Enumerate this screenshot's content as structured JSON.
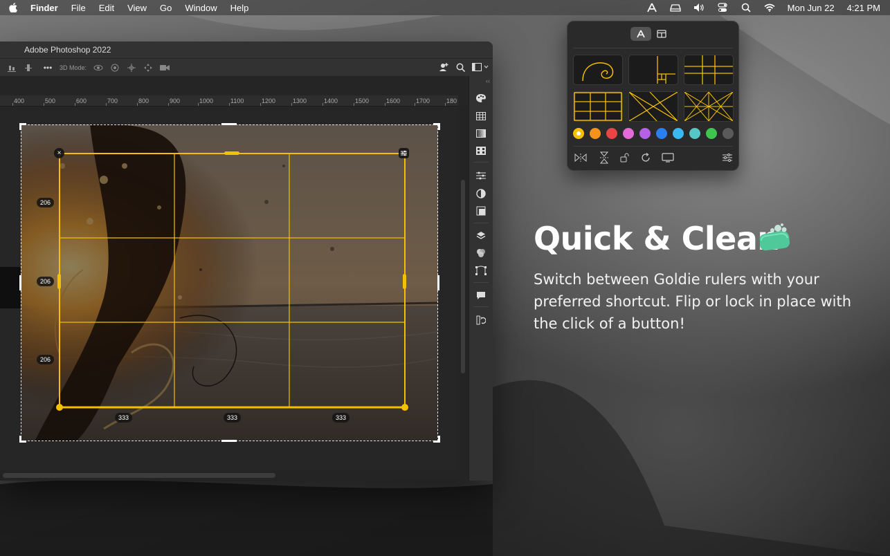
{
  "menubar": {
    "app_name": "Finder",
    "menus": [
      "File",
      "Edit",
      "View",
      "Go",
      "Window",
      "Help"
    ],
    "date": "Mon Jun 22",
    "time": "4:21 PM"
  },
  "photoshop": {
    "title": "Adobe Photoshop 2022",
    "options": {
      "mode_label": "3D Mode:"
    },
    "ruler_ticks": [
      "400",
      "500",
      "600",
      "700",
      "800",
      "900",
      "1000",
      "1100",
      "1200",
      "1300",
      "1400",
      "1500",
      "1600",
      "1700",
      "180"
    ]
  },
  "overlay": {
    "row_labels": [
      "206",
      "206",
      "206"
    ],
    "column_labels": [
      "333",
      "333",
      "333"
    ],
    "close_glyph": "×",
    "accent": "#f5c000"
  },
  "goldie": {
    "tabs": [
      "rulers-icon",
      "layout-icon"
    ],
    "rulers": [
      "golden-spiral",
      "golden-ratio-boxes",
      "phi-grid",
      "rule-of-thirds",
      "diagonals",
      "harmonic-armature"
    ],
    "colors": [
      "#f5c000",
      "#f5921e",
      "#eb4444",
      "#e36ad8",
      "#b660e8",
      "#2a7ef0",
      "#3ab9f0",
      "#56c6c6",
      "#3ec64e",
      "#5a5a5a"
    ],
    "selected_color": "#f5c000",
    "bottom_actions": [
      "flip-horizontal-icon",
      "flip-vertical-icon",
      "lock-icon",
      "rotate-icon",
      "display-icon",
      "settings-icon"
    ]
  },
  "promo": {
    "headline": "Quick & Clean",
    "description": "Switch between Goldie rulers with your preferred shortcut. Flip or lock in place with the click of a button!"
  }
}
